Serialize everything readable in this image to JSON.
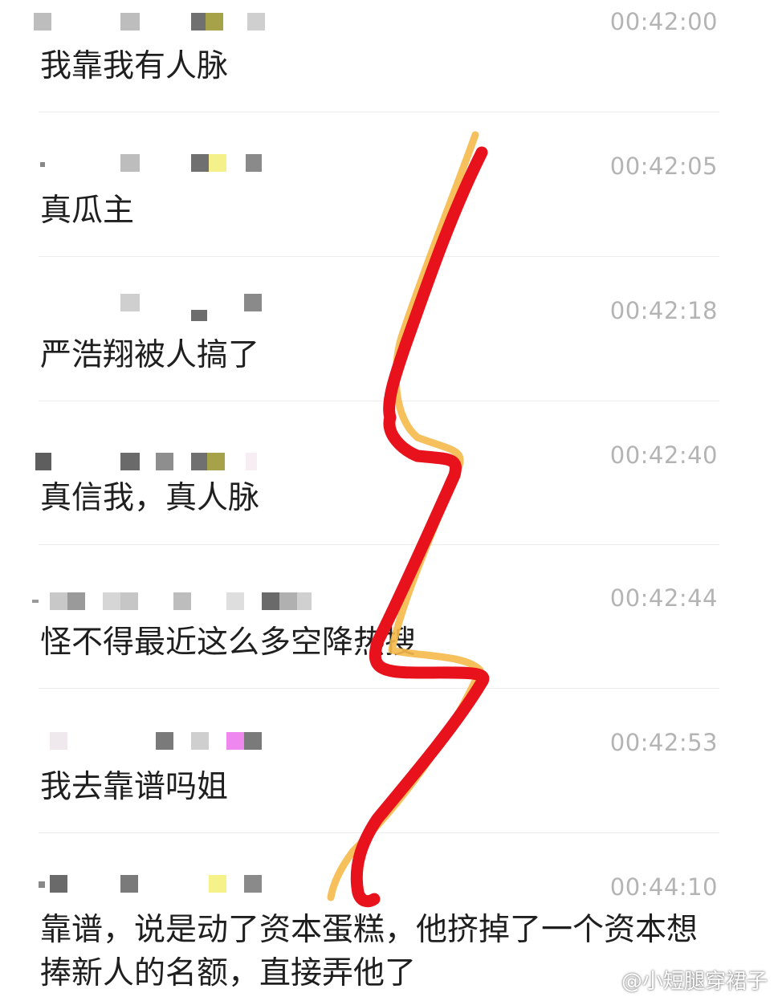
{
  "messages": [
    {
      "time": "00:42:00",
      "text": "我靠我有人脉"
    },
    {
      "time": "00:42:05",
      "text": "真瓜主"
    },
    {
      "time": "00:42:18",
      "text": "严浩翔被人搞了"
    },
    {
      "time": "00:42:40",
      "text": "真信我，真人脉"
    },
    {
      "time": "00:42:44",
      "text": "怪不得最近这么多空降热搜"
    },
    {
      "time": "00:42:53",
      "text": "我去靠谱吗姐"
    },
    {
      "time": "00:44:10",
      "text": "靠谱，说是动了资本蛋糕，他挤掉了一个资本想捧新人的名额，直接弄他了"
    }
  ],
  "watermark": "@小短腿穿裙子",
  "colors": {
    "scribble_red": "#e8121c",
    "scribble_yellow": "#f5b94a",
    "time_gray": "#b4b4b4",
    "text_dark": "#1f1f1f"
  }
}
